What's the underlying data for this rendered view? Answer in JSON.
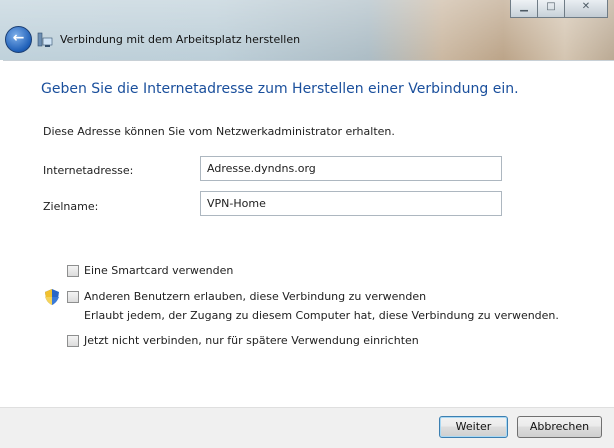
{
  "window": {
    "title": "Verbindung mit dem Arbeitsplatz herstellen",
    "controls": {
      "minimize_icon": "minimize-icon",
      "maximize_icon": "maximize-icon",
      "close_icon": "close-icon"
    },
    "back_icon": "back-arrow-icon",
    "app_icon": "network-connection-icon"
  },
  "main": {
    "heading": "Geben Sie die Internetadresse zum Herstellen einer Verbindung ein.",
    "intro": "Diese Adresse können Sie vom Netzwerkadministrator erhalten.",
    "fields": {
      "address": {
        "label": "Internetadresse:",
        "value": "Adresse.dyndns.org"
      },
      "destination": {
        "label": "Zielname:",
        "value": "VPN-Home"
      }
    },
    "options": {
      "smartcard": {
        "label": "Eine Smartcard verwenden",
        "checked": false
      },
      "allow_others": {
        "label": "Anderen Benutzern erlauben, diese Verbindung zu verwenden",
        "description": "Erlaubt jedem, der Zugang zu diesem Computer hat, diese Verbindung zu verwenden.",
        "checked": false,
        "icon": "uac-shield-icon"
      },
      "dont_connect": {
        "label": "Jetzt nicht verbinden, nur für spätere Verwendung einrichten",
        "checked": false
      }
    }
  },
  "footer": {
    "next_label": "Weiter",
    "cancel_label": "Abbrechen"
  },
  "colors": {
    "heading": "#1a4f9c",
    "default_button_border": "#3c7fb1"
  }
}
